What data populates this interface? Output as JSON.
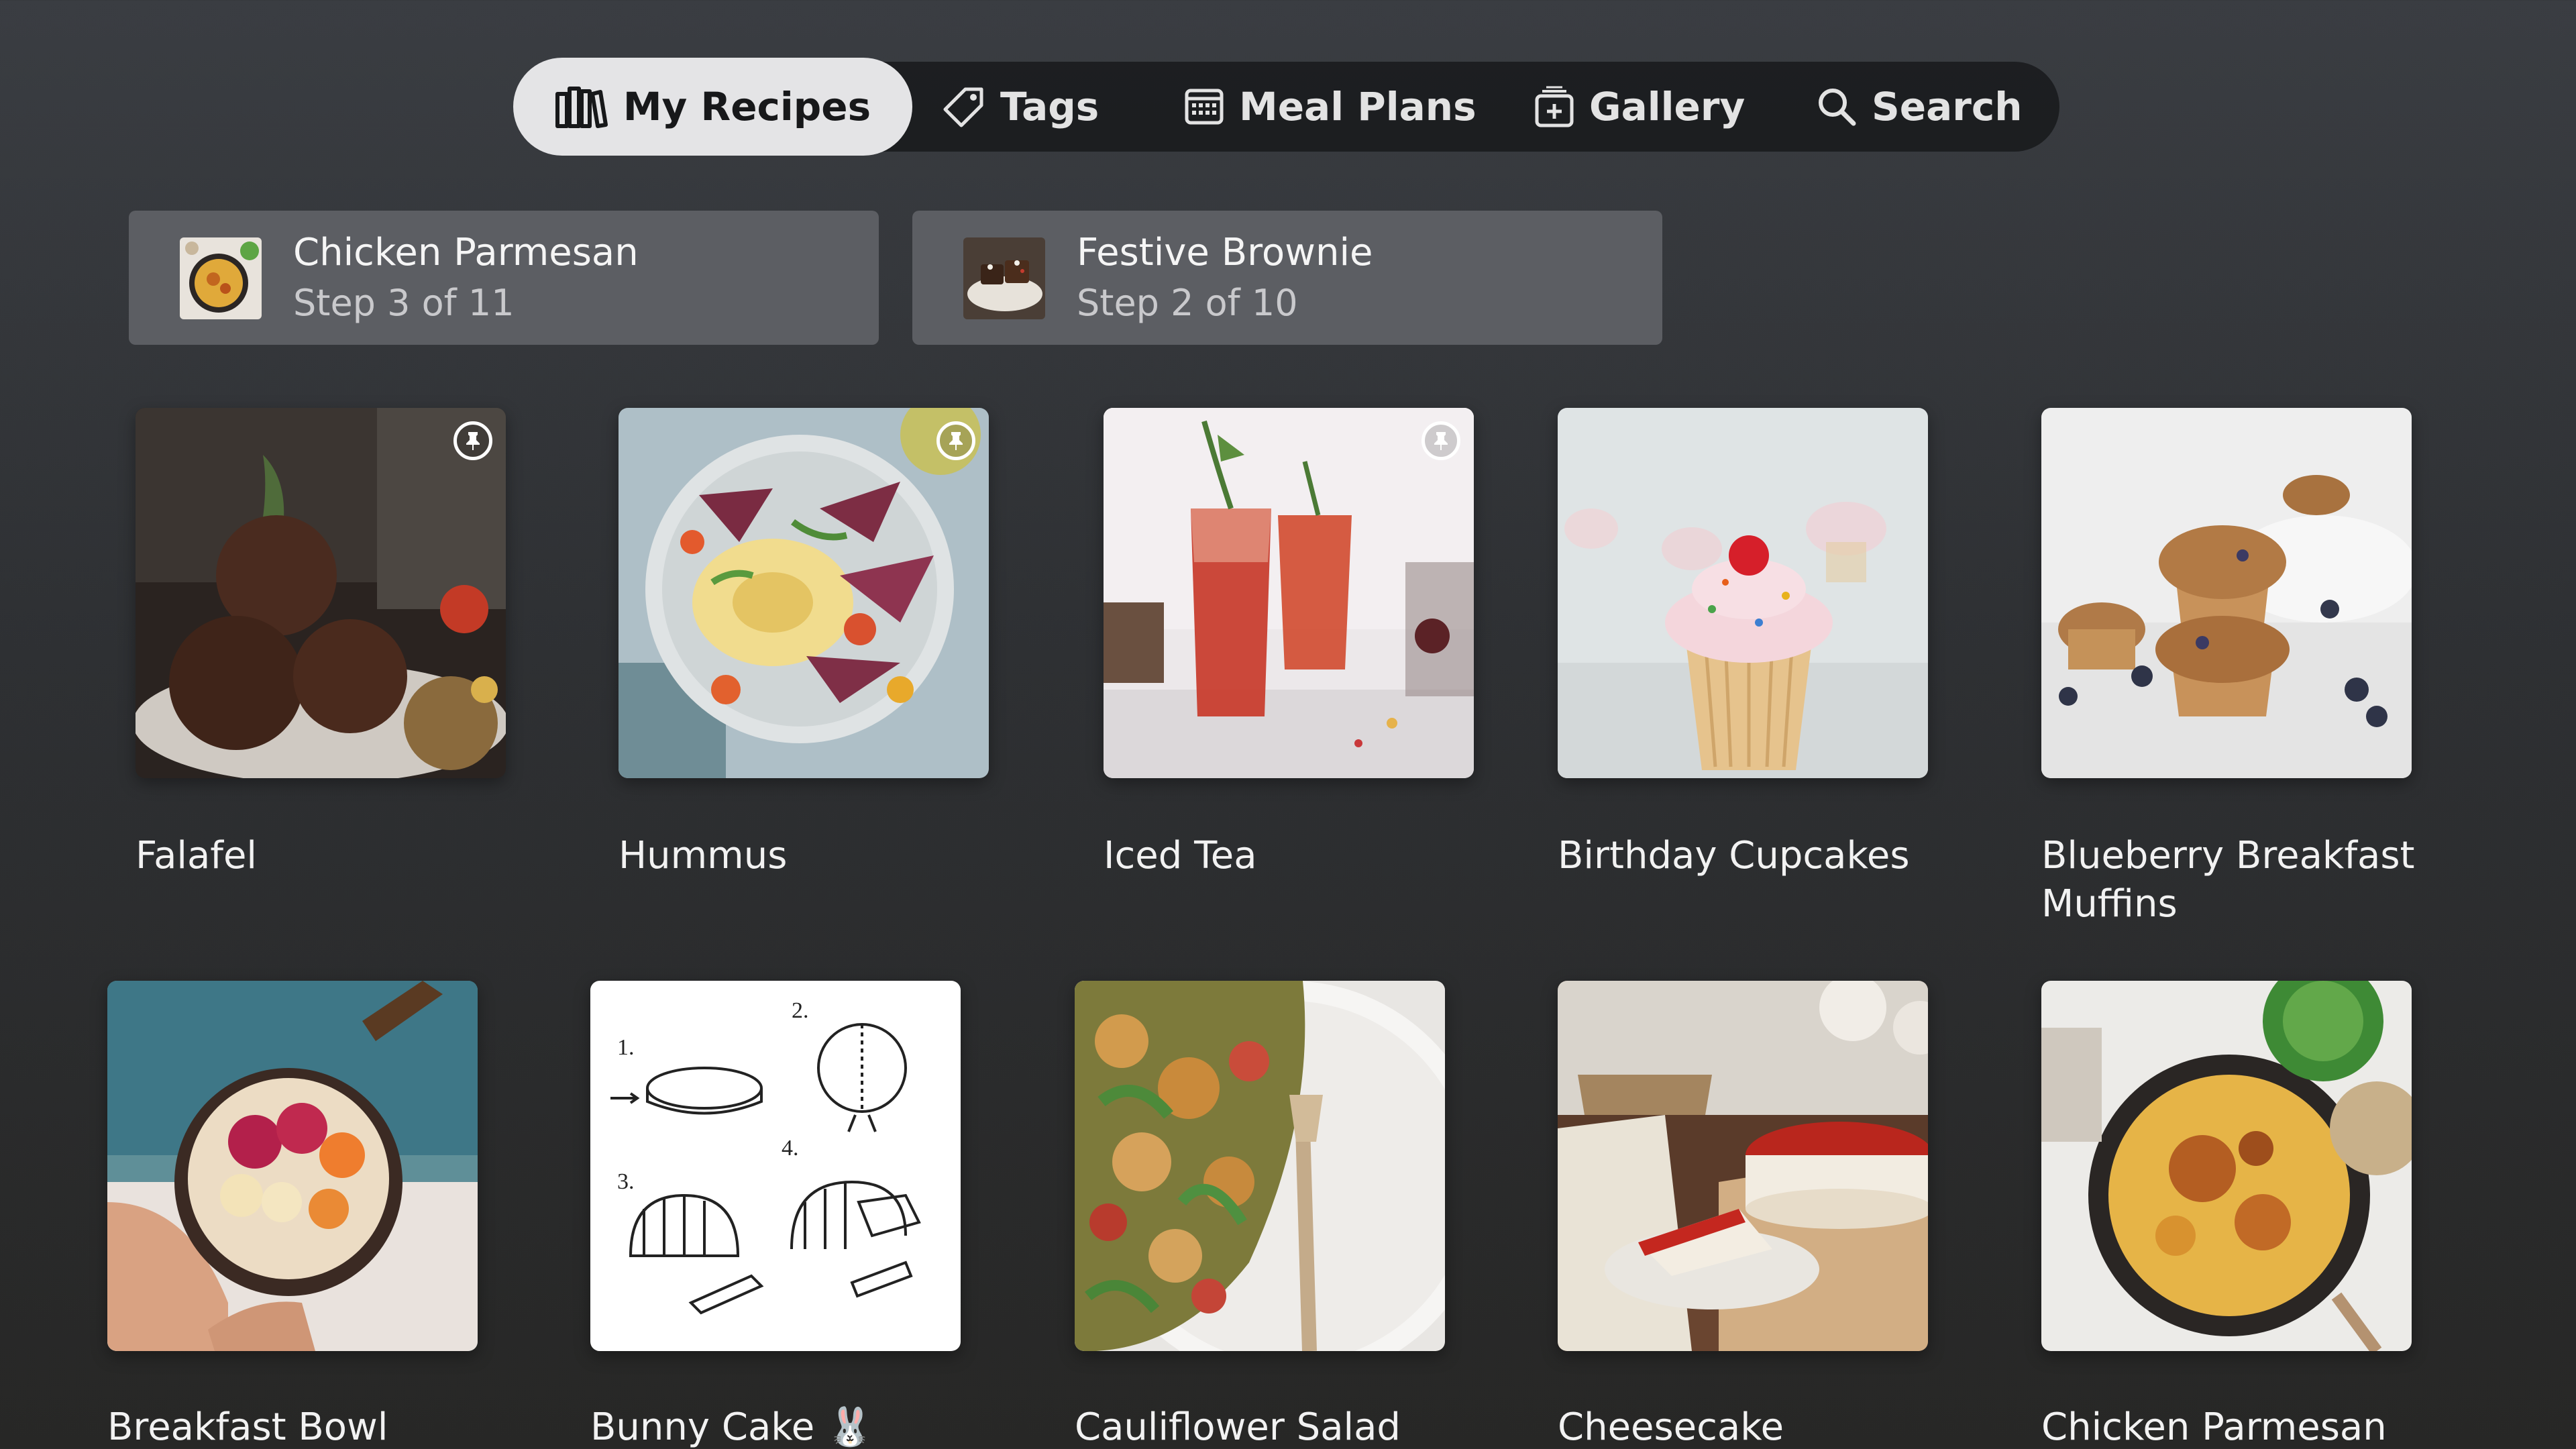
{
  "nav": {
    "tabs": [
      {
        "label": "My Recipes",
        "icon": "books-icon",
        "active": true
      },
      {
        "label": "Tags",
        "icon": "tag-icon",
        "active": false
      },
      {
        "label": "Meal Plans",
        "icon": "calendar-icon",
        "active": false
      },
      {
        "label": "Gallery",
        "icon": "gallery-icon",
        "active": false
      },
      {
        "label": "Search",
        "icon": "search-icon",
        "active": false
      }
    ]
  },
  "in_progress": [
    {
      "title": "Chicken Parmesan",
      "step": "Step 3 of 11"
    },
    {
      "title": "Festive Brownie",
      "step": "Step 2 of 10"
    }
  ],
  "recipes": [
    {
      "name": "Falafel",
      "pinned": true
    },
    {
      "name": "Hummus",
      "pinned": true
    },
    {
      "name": "Iced Tea",
      "pinned": true
    },
    {
      "name": "Birthday Cupcakes",
      "pinned": false
    },
    {
      "name": "Blueberry Breakfast Muffins",
      "pinned": false
    },
    {
      "name": "Breakfast Bowl",
      "pinned": false
    },
    {
      "name": "Bunny Cake 🐰",
      "pinned": false
    },
    {
      "name": "Cauliflower Salad",
      "pinned": false
    },
    {
      "name": "Cheesecake",
      "pinned": false
    },
    {
      "name": "Chicken Parmesan",
      "pinned": false
    }
  ],
  "colors": {
    "background": "#2e3033",
    "active_tab": "#e4e4e6",
    "card": "#5c5e63"
  }
}
